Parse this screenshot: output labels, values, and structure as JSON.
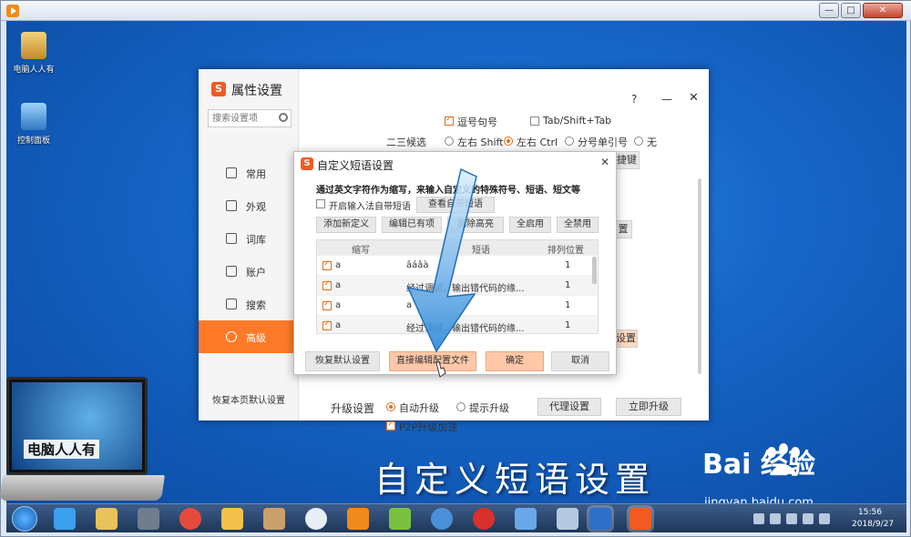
{
  "desktop": {
    "icons": [
      {
        "label": "电脑人人有"
      },
      {
        "label": "控制面板"
      }
    ]
  },
  "settings": {
    "title": "属性设置",
    "search_placeholder": "搜索设置项",
    "nav": [
      {
        "label": "常用"
      },
      {
        "label": "外观"
      },
      {
        "label": "词库"
      },
      {
        "label": "账户"
      },
      {
        "label": "搜索"
      },
      {
        "label": "高级"
      }
    ],
    "active_nav": "高级",
    "restore_page_label": "恢复本页默认设置",
    "help_label": "?",
    "punct_option_label": "逗号句号",
    "tab_option_label": "Tab/Shift+Tab",
    "candidate23_label": "二三候选",
    "candidate_options": [
      "左右 Shift",
      "左右 Ctrl",
      "分号单引号",
      "无"
    ],
    "partial_btn_1": "捷键",
    "partial_btn_2": "置",
    "partial_btn_3": "设置",
    "upgrade_label": "升级设置",
    "upgrade_auto": "自动升级",
    "upgrade_prompt": "提示升级",
    "proxy_btn": "代理设置",
    "upgrade_now_btn": "立即升级",
    "p2p_label": "P2P升级加速"
  },
  "phrase_dialog": {
    "title": "自定义短语设置",
    "description": "通过英文字符作为缩写，来输入自定义的特殊符号、短语、短文等",
    "enable_label": "开启输入法自带短语",
    "view_btn": "查看自带短语",
    "toolbar": [
      "添加新定义",
      "编辑已有项",
      "删除高亮",
      "全启用",
      "全禁用"
    ],
    "columns": [
      "缩写",
      "短语",
      "排列位置"
    ],
    "rows": [
      {
        "abbr": "a",
        "phrase": "āáǎà",
        "pos": "1"
      },
      {
        "abbr": "a",
        "phrase": "经过调试，输出错代码的缘...",
        "pos": "1"
      },
      {
        "abbr": "a",
        "phrase": "a",
        "pos": "1"
      },
      {
        "abbr": "a",
        "phrase": "经过调试，输出错代码的缘...",
        "pos": "1"
      }
    ],
    "footer": {
      "restore": "恢复默认设置",
      "edit_config": "直接编辑配置文件",
      "ok": "确定",
      "cancel": "取消"
    }
  },
  "caption": "自定义短语设置",
  "brand": {
    "name": "Bai  经验",
    "url": "jingyan.baidu.com"
  },
  "laptop_label": "电脑人人有",
  "clock": {
    "time": "15:56",
    "date": "2018/9/27"
  },
  "colors": {
    "accent": "#ff7a28",
    "desktop_blue": "#1666c9",
    "arrow_blue": "#4aa3e8"
  }
}
